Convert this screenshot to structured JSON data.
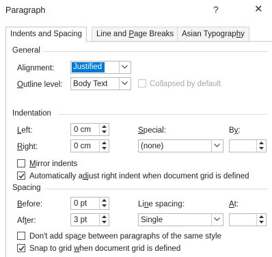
{
  "dialog": {
    "title": "Paragraph",
    "help_glyph": "?",
    "close_glyph": "✕"
  },
  "tabs": [
    {
      "label": "Indents and Spacing",
      "active": true
    },
    {
      "label": "Line and Page Breaks",
      "active": false
    },
    {
      "label": "Asian Typography",
      "active": false
    }
  ],
  "general": {
    "heading": "General",
    "alignment_label": "Alignment:",
    "alignment_value": "Justified",
    "outline_label": "Outline level:",
    "outline_value": "Body Text",
    "collapsed_label": "Collapsed by default",
    "collapsed_checked": false
  },
  "indentation": {
    "heading": "Indentation",
    "left_label": "Left:",
    "left_value": "0 cm",
    "right_label": "Right:",
    "right_value": "0 cm",
    "special_label": "Special:",
    "special_value": "(none)",
    "by_label": "By:",
    "by_value": "",
    "mirror_label": "Mirror indents",
    "mirror_checked": false,
    "auto_adjust_label": "Automatically adjust right indent when document grid is defined",
    "auto_adjust_checked": true
  },
  "spacing": {
    "heading": "Spacing",
    "before_label": "Before:",
    "before_value": "0 pt",
    "after_label": "After:",
    "after_value": "3 pt",
    "line_spacing_label": "Line spacing:",
    "line_spacing_value": "Single",
    "at_label": "At:",
    "at_value": "",
    "dont_add_label": "Don't add space between paragraphs of the same style",
    "dont_add_checked": false,
    "snap_label": "Snap to grid when document grid is defined",
    "snap_checked": true
  }
}
